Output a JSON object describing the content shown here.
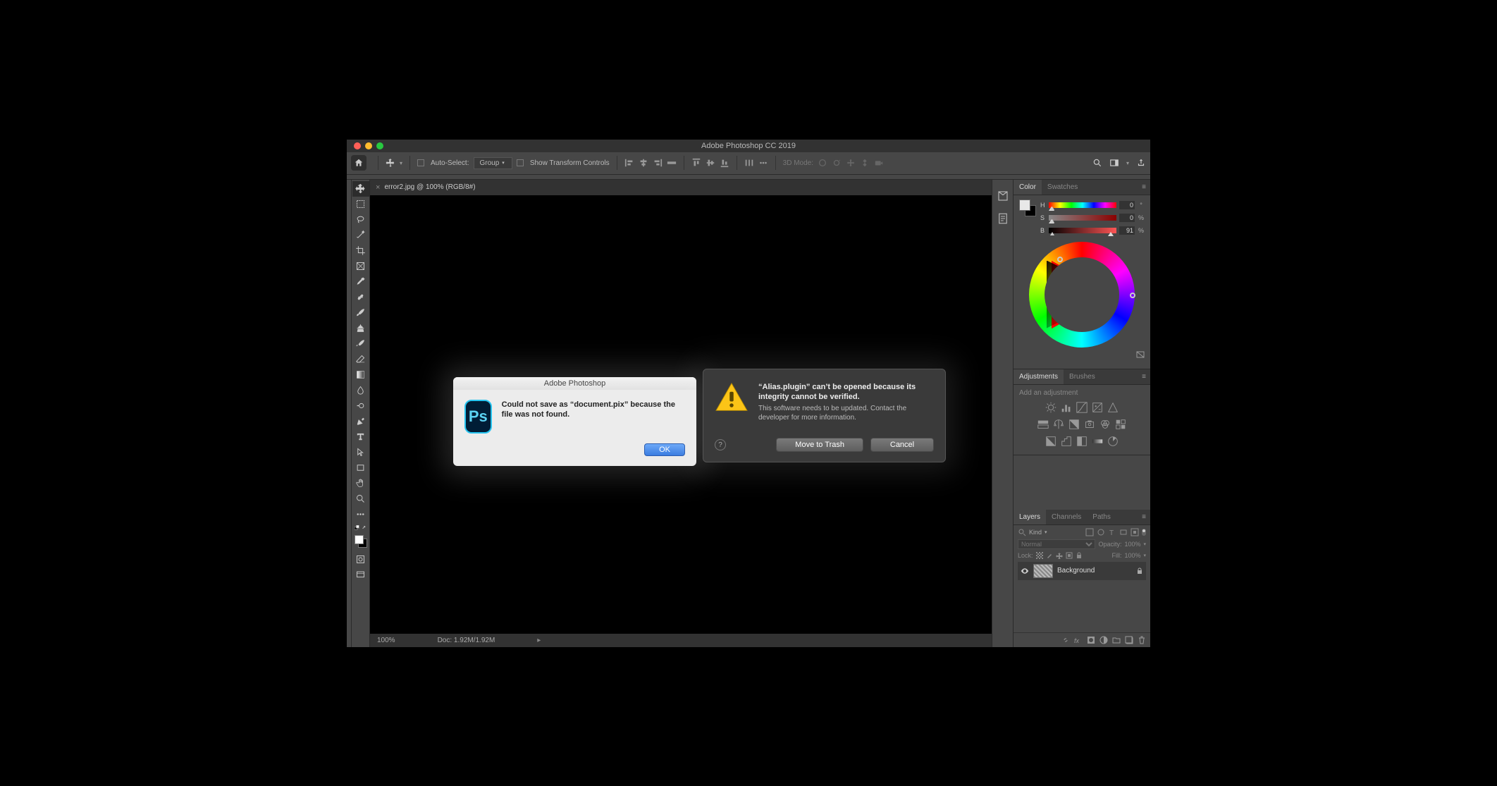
{
  "titlebar": {
    "title": "Adobe Photoshop CC 2019"
  },
  "optionsbar": {
    "auto_select_label": "Auto-Select:",
    "auto_select_value": "Group",
    "show_transform": "Show Transform Controls",
    "mode_3d": "3D Mode:"
  },
  "tab": {
    "close": "×",
    "label": "error2.jpg @ 100% (RGB/8#)"
  },
  "panels": {
    "color_tab": "Color",
    "swatches_tab": "Swatches",
    "adjustments_tab": "Adjustments",
    "brushes_tab": "Brushes",
    "layers_tab": "Layers",
    "channels_tab": "Channels",
    "paths_tab": "Paths",
    "add_adjustment": "Add an adjustment"
  },
  "color": {
    "h_label": "H",
    "h_val": "0",
    "h_unit": "°",
    "s_label": "S",
    "s_val": "0",
    "s_unit": "%",
    "b_label": "B",
    "b_val": "91",
    "b_unit": "%"
  },
  "layers": {
    "kind": "Kind",
    "blend": "Normal",
    "opacity_label": "Opacity:",
    "opacity_val": "100%",
    "lock_label": "Lock:",
    "fill_label": "Fill:",
    "fill_val": "100%",
    "bg_name": "Background"
  },
  "status": {
    "zoom": "100%",
    "doc": "Doc: 1.92M/1.92M"
  },
  "dialog1": {
    "title": "Adobe Photoshop",
    "text": "Could not save as “document.pix” because the file was not found.",
    "ok": "OK",
    "ps_label": "Ps"
  },
  "dialog2": {
    "heading": "“Alias.plugin” can’t be opened because its integrity cannot be verified.",
    "body": "This software needs to be updated. Contact the developer for more information.",
    "help": "?",
    "trash": "Move to Trash",
    "cancel": "Cancel"
  }
}
